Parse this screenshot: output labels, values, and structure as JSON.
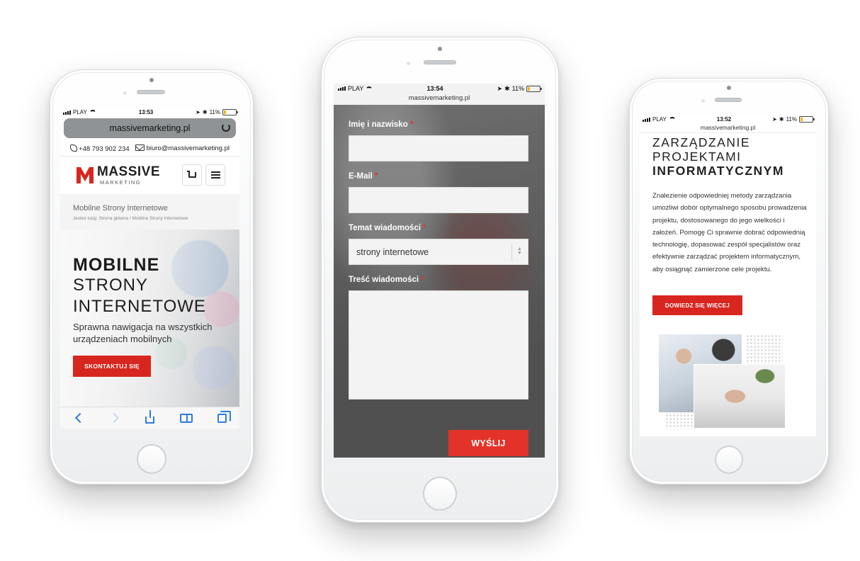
{
  "phone_left": {
    "status": {
      "carrier": "PLAY",
      "time": "13:53",
      "battery": "11%"
    },
    "url": "massivemarketing.pl",
    "contact": {
      "phone": "+48 793 902 234",
      "email": "biuro@massivemarketing.pl"
    },
    "logo": {
      "name": "MASSIVE",
      "sub": "MARKETING"
    },
    "breadcrumb": {
      "title": "Mobilne Strony Internetowe",
      "path": "Jesteś tutaj:  Strona główna  /  Mobilne Strony Internetowe"
    },
    "hero": {
      "line1": "MOBILNE",
      "line2": "STRONY",
      "line3": "INTERNETOWE",
      "subtitle": "Sprawna nawigacja na wszystkich urządzeniach mobilnych",
      "cta": "SKONTAKTUJ SIĘ"
    }
  },
  "phone_center": {
    "status": {
      "carrier": "PLAY",
      "time": "13:54",
      "battery": "11%"
    },
    "url": "massivemarketing.pl",
    "form": {
      "name_label": "Imię i nazwisko",
      "email_label": "E-Mail",
      "subject_label": "Temat wiadomości",
      "subject_value": "strony internetowe",
      "message_label": "Treść wiadomości",
      "required_mark": "*",
      "submit": "WYŚLIJ"
    }
  },
  "phone_right": {
    "status": {
      "carrier": "PLAY",
      "time": "13:52",
      "battery": "11%"
    },
    "url": "massivemarketing.pl",
    "heading": {
      "line1": "ZARZĄDZANIE",
      "line2": "PROJEKTAMI",
      "line3": "INFORMATYCZNYM"
    },
    "body": "Znalezienie odpowiedniej metody zarządzania umożliwi dobór optymalnego sposobu prowadzenia projektu, dostosowanego do jego wielkości i założeń. Pomogę Ci sprawnie dobrać odpowiednią technologię, dopasować zespół specjalistów oraz efektywnie zarządzać projektem informatycznym, aby osiągnąć zamierzone cele projektu.",
    "cta": "DOWIEDZ SIĘ WIĘCEJ"
  },
  "colors": {
    "accent": "#d7261f",
    "button_red": "#e2322a",
    "ios_blue": "#2f7be0"
  }
}
